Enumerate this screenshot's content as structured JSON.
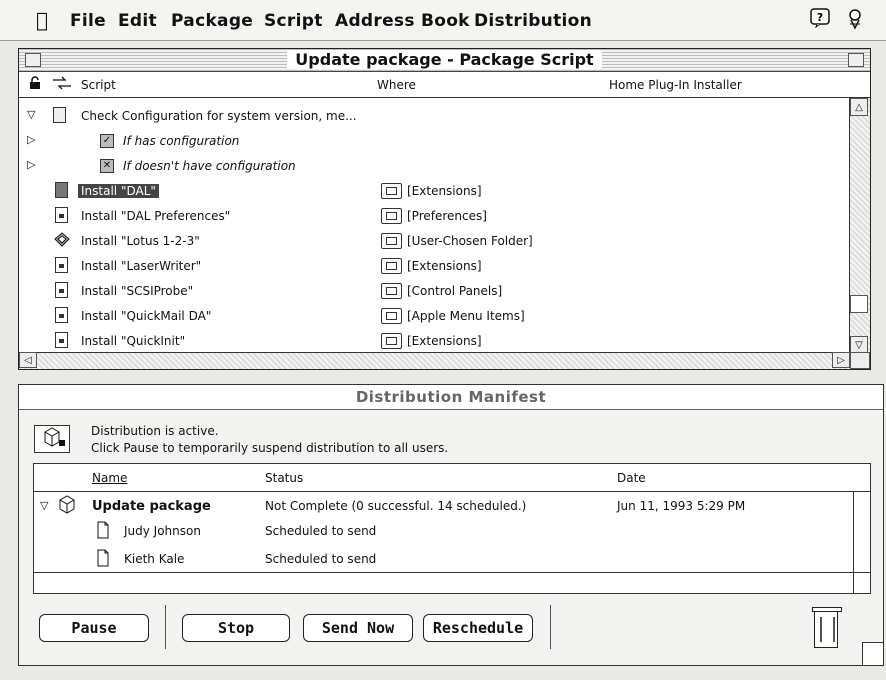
{
  "menubar": {
    "items": [
      "File",
      "Edit",
      "Package",
      "Script",
      "Address Book",
      "Distribution"
    ],
    "help_icon": "help-balloon-icon",
    "app_icon": "application-menu-icon"
  },
  "script_window": {
    "title": "Update package - Package Script",
    "columns": {
      "script": "Script",
      "where": "Where",
      "installer": "Home Plug-In Installer"
    },
    "rows": [
      {
        "name": "Check Configuration for system version, me...",
        "where": "",
        "kind": "config",
        "expanded": true
      },
      {
        "name": "If has configuration",
        "where": "",
        "kind": "branch"
      },
      {
        "name": "If doesn't have configuration",
        "where": "",
        "kind": "branch"
      },
      {
        "name": "Install \"DAL\"",
        "where": "[Extensions]",
        "kind": "install",
        "selected": true
      },
      {
        "name": "Install \"DAL Preferences\"",
        "where": "[Preferences]",
        "kind": "install"
      },
      {
        "name": "Install \"Lotus 1-2-3\"",
        "where": "[User-Chosen Folder]",
        "kind": "install"
      },
      {
        "name": "Install \"LaserWriter\"",
        "where": "[Extensions]",
        "kind": "install"
      },
      {
        "name": "Install \"SCSIProbe\"",
        "where": "[Control Panels]",
        "kind": "install"
      },
      {
        "name": "Install \"QuickMail DA\"",
        "where": "[Apple Menu Items]",
        "kind": "install"
      },
      {
        "name": "Install \"QuickInit\"",
        "where": "[Extensions]",
        "kind": "install"
      }
    ]
  },
  "manifest_window": {
    "title": "Distribution Manifest",
    "status_line1": "Distribution is active.",
    "status_line2": "Click Pause to temporarily suspend distribution to all users.",
    "columns": {
      "name": "Name",
      "status": "Status",
      "date": "Date"
    },
    "package": {
      "name": "Update package",
      "status": "Not Complete (0 successful. 14 scheduled.)",
      "date": "Jun 11, 1993 5:29 PM"
    },
    "recipients": [
      {
        "name": "Judy Johnson",
        "status": "Scheduled to send"
      },
      {
        "name": "Kieth Kale",
        "status": "Scheduled to send"
      }
    ],
    "buttons": {
      "pause": "Pause",
      "stop": "Stop",
      "send_now": "Send Now",
      "reschedule": "Reschedule"
    }
  }
}
